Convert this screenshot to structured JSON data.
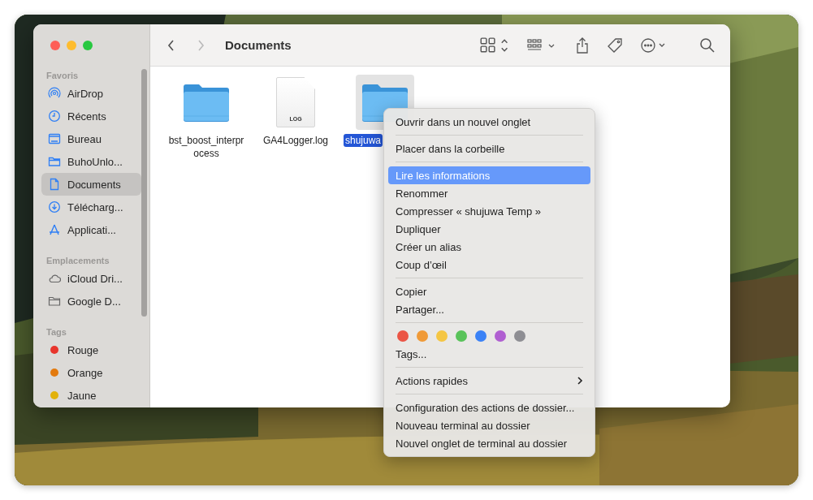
{
  "window": {
    "title": "Documents"
  },
  "toolbar": {
    "back": {
      "disabled": false
    },
    "forward": {
      "disabled": true
    }
  },
  "sidebar": {
    "sections": [
      {
        "title": "Favoris",
        "items": [
          {
            "label": "AirDrop",
            "selected": false
          },
          {
            "label": "Récents",
            "selected": false
          },
          {
            "label": "Bureau",
            "selected": false
          },
          {
            "label": "BuhoUnlo...",
            "selected": false
          },
          {
            "label": "Documents",
            "selected": true
          },
          {
            "label": "Télécharg...",
            "selected": false
          },
          {
            "label": "Applicati...",
            "selected": false
          }
        ]
      },
      {
        "title": "Emplacements",
        "items": [
          {
            "label": "iCloud Dri...",
            "selected": false
          },
          {
            "label": "Google D...",
            "selected": false
          }
        ]
      },
      {
        "title": "Tags",
        "items": [
          {
            "label": "Rouge",
            "color": "#e8352c",
            "selected": false
          },
          {
            "label": "Orange",
            "color": "#e37a0e",
            "selected": false
          },
          {
            "label": "Jaune",
            "color": "#e2b20b",
            "selected": false
          }
        ]
      }
    ]
  },
  "files": [
    {
      "name": "bst_boost_interprocess",
      "kind": "folder",
      "selected": false
    },
    {
      "name": "GA4Logger.log",
      "kind": "log",
      "badge": "LOG",
      "selected": false
    },
    {
      "name": "shujuwa",
      "kind": "folder",
      "selected": true
    }
  ],
  "context_menu": {
    "sections": [
      [
        {
          "kind": "item",
          "label": "Ouvrir dans un nouvel onglet",
          "selected": false
        }
      ],
      [
        {
          "kind": "item",
          "label": "Placer dans la corbeille",
          "selected": false
        }
      ],
      [
        {
          "kind": "item",
          "label": "Lire les informations",
          "selected": true
        },
        {
          "kind": "item",
          "label": "Renommer",
          "selected": false
        },
        {
          "kind": "item",
          "label": "Compresser « shujuwa Temp »",
          "selected": false
        },
        {
          "kind": "item",
          "label": "Dupliquer",
          "selected": false
        },
        {
          "kind": "item",
          "label": "Créer un alias",
          "selected": false
        },
        {
          "kind": "item",
          "label": "Coup d’œil",
          "selected": false
        }
      ],
      [
        {
          "kind": "item",
          "label": "Copier",
          "selected": false
        },
        {
          "kind": "item",
          "label": "Partager...",
          "selected": false
        }
      ],
      [
        {
          "kind": "colors",
          "tags": [
            {
              "color": "#eb5545"
            },
            {
              "color": "#f09a37"
            },
            {
              "color": "#f5c643"
            },
            {
              "color": "#59c35a"
            },
            {
              "color": "#3b82f6"
            },
            {
              "color": "#b05fd1"
            },
            {
              "color": "#8e8e93"
            }
          ]
        },
        {
          "kind": "item",
          "label": "Tags...",
          "selected": false
        }
      ],
      [
        {
          "kind": "submenu",
          "label": "Actions rapides",
          "selected": false
        }
      ],
      [
        {
          "kind": "item",
          "label": "Configuration des actions de dossier...",
          "selected": false
        },
        {
          "kind": "item",
          "label": "Nouveau terminal au dossier",
          "selected": false
        },
        {
          "kind": "item",
          "label": "Nouvel onglet de terminal au dossier",
          "selected": false
        }
      ]
    ]
  }
}
